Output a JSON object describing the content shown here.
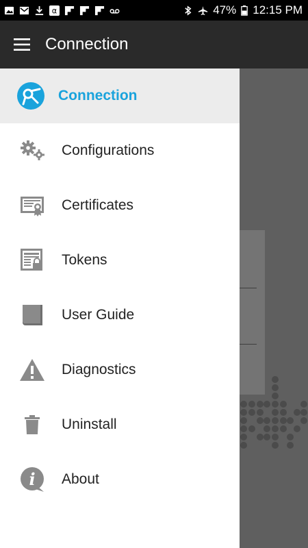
{
  "status_bar": {
    "battery": "47%",
    "time": "12:15 PM"
  },
  "toolbar": {
    "title": "Connection"
  },
  "drawer": {
    "header": {
      "label": "Connection",
      "icon": "connection-logo-icon",
      "color": "#1aa3dc"
    },
    "items": [
      {
        "label": "Configurations",
        "icon": "gears-icon"
      },
      {
        "label": "Certificates",
        "icon": "certificate-icon"
      },
      {
        "label": "Tokens",
        "icon": "token-lock-icon"
      },
      {
        "label": "User Guide",
        "icon": "book-icon"
      },
      {
        "label": "Diagnostics",
        "icon": "warning-icon"
      },
      {
        "label": "Uninstall",
        "icon": "trash-icon"
      },
      {
        "label": "About",
        "icon": "info-icon"
      }
    ]
  }
}
